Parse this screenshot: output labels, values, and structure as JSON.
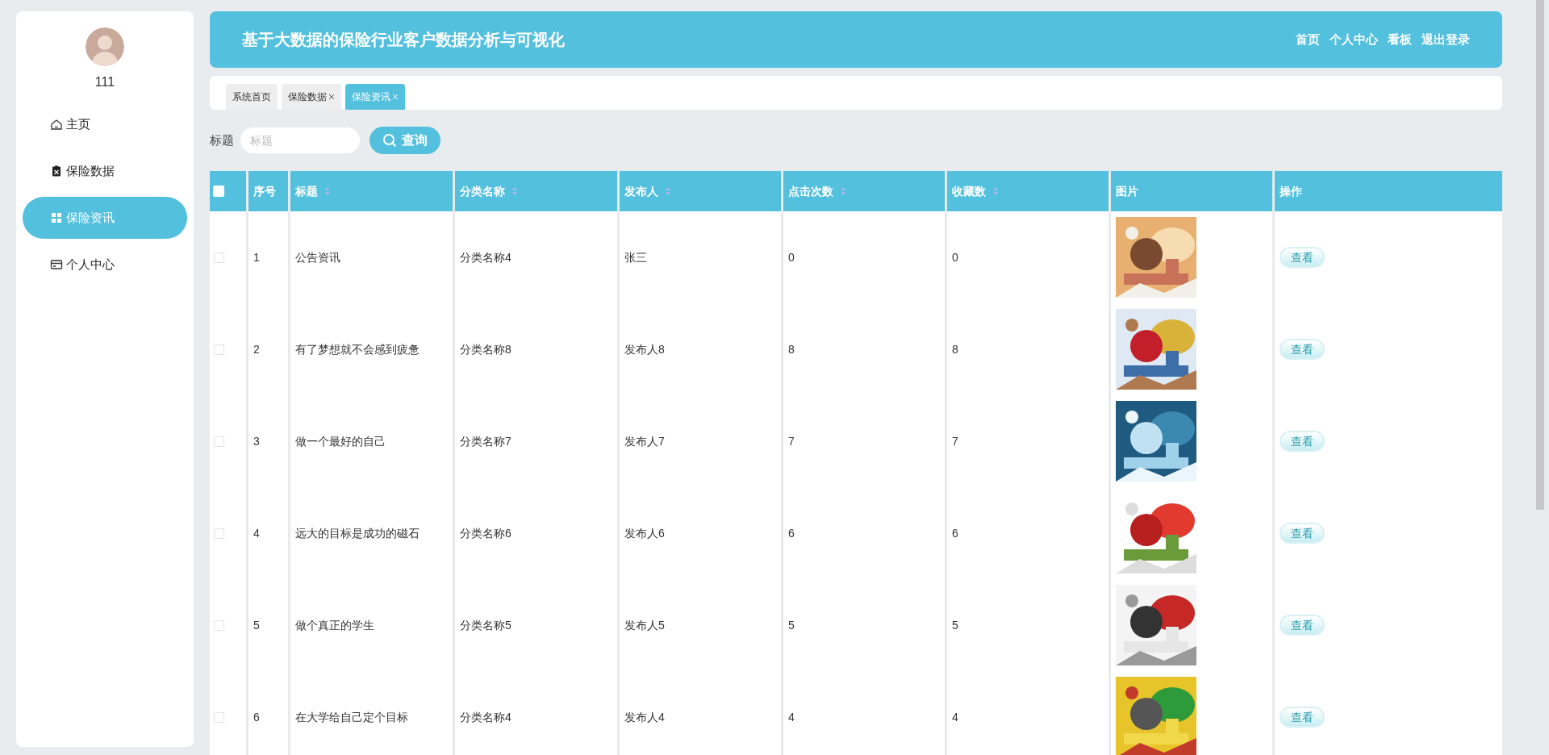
{
  "sidebar": {
    "user": {
      "name": "111"
    },
    "items": [
      {
        "label": "主页",
        "selected": false
      },
      {
        "label": "保险数据",
        "selected": false
      },
      {
        "label": "保险资讯",
        "selected": true
      },
      {
        "label": "个人中心",
        "selected": false
      }
    ]
  },
  "header": {
    "title": "基于大数据的保险行业客户数据分析与可视化",
    "nav": [
      "首页",
      "个人中心",
      "看板",
      "退出登录"
    ]
  },
  "tabs": [
    {
      "label": "系统首页",
      "selected": false,
      "closable": false
    },
    {
      "label": "保险数据",
      "selected": false,
      "closable": true
    },
    {
      "label": "保险资讯",
      "selected": true,
      "closable": true
    }
  ],
  "search": {
    "label": "标题",
    "placeholder": "标题",
    "button": "查询"
  },
  "table": {
    "select_all": {
      "checked": false
    },
    "columns": [
      {
        "label": "序号",
        "sortable": false
      },
      {
        "label": "标题",
        "sortable": true
      },
      {
        "label": "分类名称",
        "sortable": true
      },
      {
        "label": "发布人",
        "sortable": true
      },
      {
        "label": "点击次数",
        "sortable": true
      },
      {
        "label": "收藏数",
        "sortable": true
      },
      {
        "label": "图片",
        "sortable": false
      },
      {
        "label": "操作",
        "sortable": false
      }
    ],
    "rows": [
      {
        "checked": false,
        "no": "1",
        "title": "公告资讯",
        "category": "分类名称4",
        "publisher": "张三",
        "clicks": "0",
        "favorites": "0",
        "action": "查看"
      },
      {
        "checked": false,
        "no": "2",
        "title": "有了梦想就不会感到疲惫",
        "category": "分类名称8",
        "publisher": "发布人8",
        "clicks": "8",
        "favorites": "8",
        "action": "查看"
      },
      {
        "checked": false,
        "no": "3",
        "title": "做一个最好的自己",
        "category": "分类名称7",
        "publisher": "发布人7",
        "clicks": "7",
        "favorites": "7",
        "action": "查看"
      },
      {
        "checked": false,
        "no": "4",
        "title": "远大的目标是成功的磁石",
        "category": "分类名称6",
        "publisher": "发布人6",
        "clicks": "6",
        "favorites": "6",
        "action": "查看"
      },
      {
        "checked": false,
        "no": "5",
        "title": "做个真正的学生",
        "category": "分类名称5",
        "publisher": "发布人5",
        "clicks": "5",
        "favorites": "5",
        "action": "查看"
      },
      {
        "checked": false,
        "no": "6",
        "title": "在大学给自己定个目标",
        "category": "分类名称4",
        "publisher": "发布人4",
        "clicks": "4",
        "favorites": "4",
        "action": "查看"
      }
    ]
  }
}
